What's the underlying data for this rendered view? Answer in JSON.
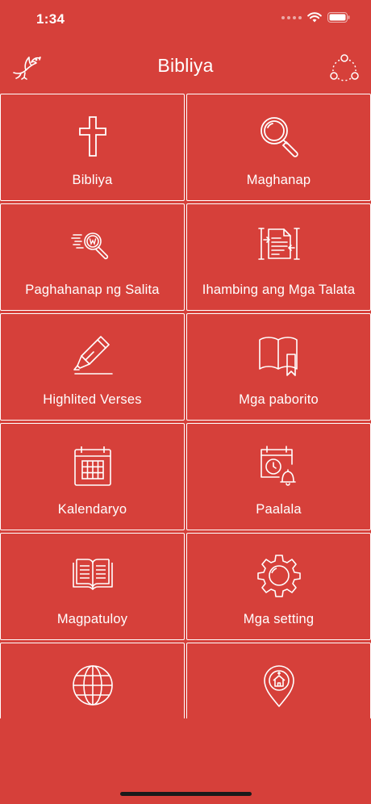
{
  "status_bar": {
    "time": "1:34"
  },
  "header": {
    "title": "Bibliya"
  },
  "menu": {
    "items": [
      {
        "label": "Bibliya",
        "icon": "cross-icon"
      },
      {
        "label": "Maghanap",
        "icon": "magnifier-icon"
      },
      {
        "label": "Paghahanap ng Salita",
        "icon": "word-search-icon"
      },
      {
        "label": "Ihambing ang Mga Talata",
        "icon": "compare-verses-icon"
      },
      {
        "label": "Highlited Verses",
        "icon": "highlighter-icon"
      },
      {
        "label": "Mga paborito",
        "icon": "bookmark-book-icon"
      },
      {
        "label": "Kalendaryo",
        "icon": "calendar-icon"
      },
      {
        "label": "Paalala",
        "icon": "reminder-icon"
      },
      {
        "label": "Magpatuloy",
        "icon": "open-book-icon"
      },
      {
        "label": "Mga setting",
        "icon": "gear-icon"
      },
      {
        "label": "",
        "icon": "globe-icon"
      },
      {
        "label": "",
        "icon": "church-location-icon"
      }
    ]
  },
  "colors": {
    "background": "#d6403a",
    "foreground": "#ffffff"
  }
}
